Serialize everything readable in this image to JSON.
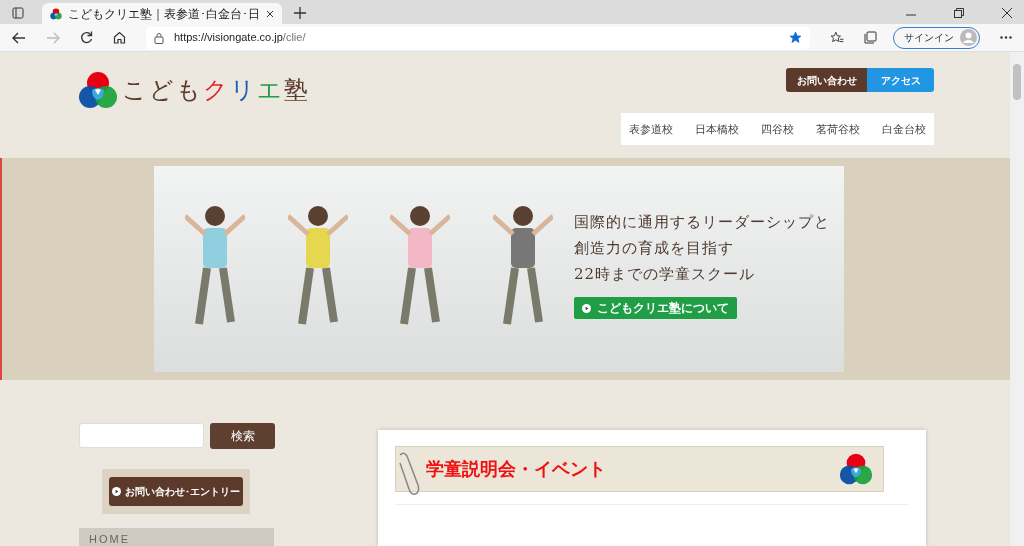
{
  "browser": {
    "tab_title": "こどもクリエ塾｜表参道･白金台･日",
    "url_host": "https://visiongate.co.jp",
    "url_path": "/clie/",
    "favorited": true,
    "signin": "サインイン"
  },
  "header": {
    "logo": [
      {
        "text": "こども",
        "color": "#5b3a2b"
      },
      {
        "text": "ク",
        "color": "#e8202a"
      },
      {
        "text": "リ",
        "color": "#1d5fb5"
      },
      {
        "text": "エ",
        "color": "#1f9e45"
      },
      {
        "text": "塾",
        "color": "#5b3a2b"
      }
    ],
    "buttons": [
      {
        "label": "お問い合わせ",
        "kind": "contact"
      },
      {
        "label": "アクセス",
        "kind": "access"
      }
    ],
    "nav": [
      "表参道校",
      "日本橋校",
      "四谷校",
      "茗荷谷校",
      "白金台校"
    ]
  },
  "hero": {
    "lines": [
      "国際的に通用するリーダーシップと",
      "創造力の育成を目指す",
      "22時までの学童スクール"
    ],
    "button": "こどもクリエ塾について"
  },
  "sidebar": {
    "search_button": "検索",
    "entry_button": "お問い合わせ･エントリー",
    "menu": [
      "HOME"
    ]
  },
  "main": {
    "heading": "学童説明会・イベント"
  }
}
